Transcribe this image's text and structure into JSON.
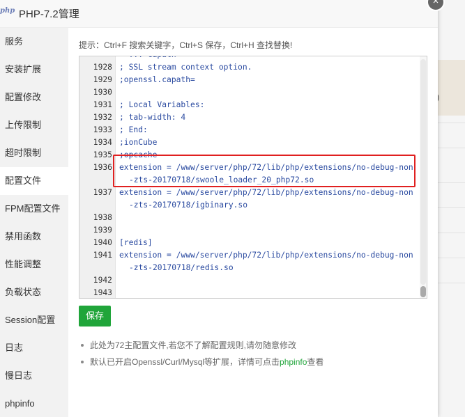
{
  "window": {
    "logo_text": "php",
    "title": "PHP-7.2管理",
    "close_symbol": "×"
  },
  "sidebar": {
    "items": [
      {
        "label": "服务"
      },
      {
        "label": "安装扩展"
      },
      {
        "label": "配置修改"
      },
      {
        "label": "上传限制"
      },
      {
        "label": "超时限制"
      },
      {
        "label": "配置文件",
        "active": true
      },
      {
        "label": "FPM配置文件"
      },
      {
        "label": "禁用函数"
      },
      {
        "label": "性能调整"
      },
      {
        "label": "负载状态"
      },
      {
        "label": "Session配置"
      },
      {
        "label": "日志"
      },
      {
        "label": "慢日志"
      },
      {
        "label": "phpinfo"
      }
    ]
  },
  "tip": "提示：Ctrl+F 搜索关键字，Ctrl+S 保存，Ctrl+H 查找替换!",
  "editor": {
    "lines": [
      {
        "num": "",
        "text": "  ... capath"
      },
      {
        "num": "1928",
        "text": "; SSL stream context option."
      },
      {
        "num": "1929",
        "text": ";openssl.capath="
      },
      {
        "num": "1930",
        "text": ""
      },
      {
        "num": "1931",
        "text": "; Local Variables:"
      },
      {
        "num": "1932",
        "text": "; tab-width: 4"
      },
      {
        "num": "1933",
        "text": "; End:"
      },
      {
        "num": "1934",
        "text": ";ionCube"
      },
      {
        "num": "1935",
        "text": ";opcache"
      },
      {
        "num": "1936",
        "text": "extension = /www/server/php/72/lib/php/extensions/no-debug-non"
      },
      {
        "num": "",
        "text": "-zts-20170718/swoole_loader_20_php72.so"
      },
      {
        "num": "1937",
        "text": "extension = /www/server/php/72/lib/php/extensions/no-debug-non"
      },
      {
        "num": "",
        "text": "-zts-20170718/igbinary.so"
      },
      {
        "num": "1938",
        "text": ""
      },
      {
        "num": "1939",
        "text": ""
      },
      {
        "num": "1940",
        "text": "[redis]"
      },
      {
        "num": "1941",
        "text": "extension = /www/server/php/72/lib/php/extensions/no-debug-non"
      },
      {
        "num": "",
        "text": "-zts-20170718/redis.so"
      },
      {
        "num": "1942",
        "text": ""
      },
      {
        "num": "1943",
        "text": ""
      }
    ]
  },
  "save_label": "保存",
  "notes": {
    "note1": "此处为72主配置文件,若您不了解配置规则,请勿随意修改",
    "note2_prefix": "默认已开启Openssl/Curl/Mysql等扩展，详情可点击",
    "note2_link": "phpinfo",
    "note2_suffix": "查看"
  },
  "background": {
    "paren": ")"
  },
  "colors": {
    "accent_green": "#20a53a",
    "highlight_red": "#e02020",
    "code_blue": "#2a4aa0"
  }
}
